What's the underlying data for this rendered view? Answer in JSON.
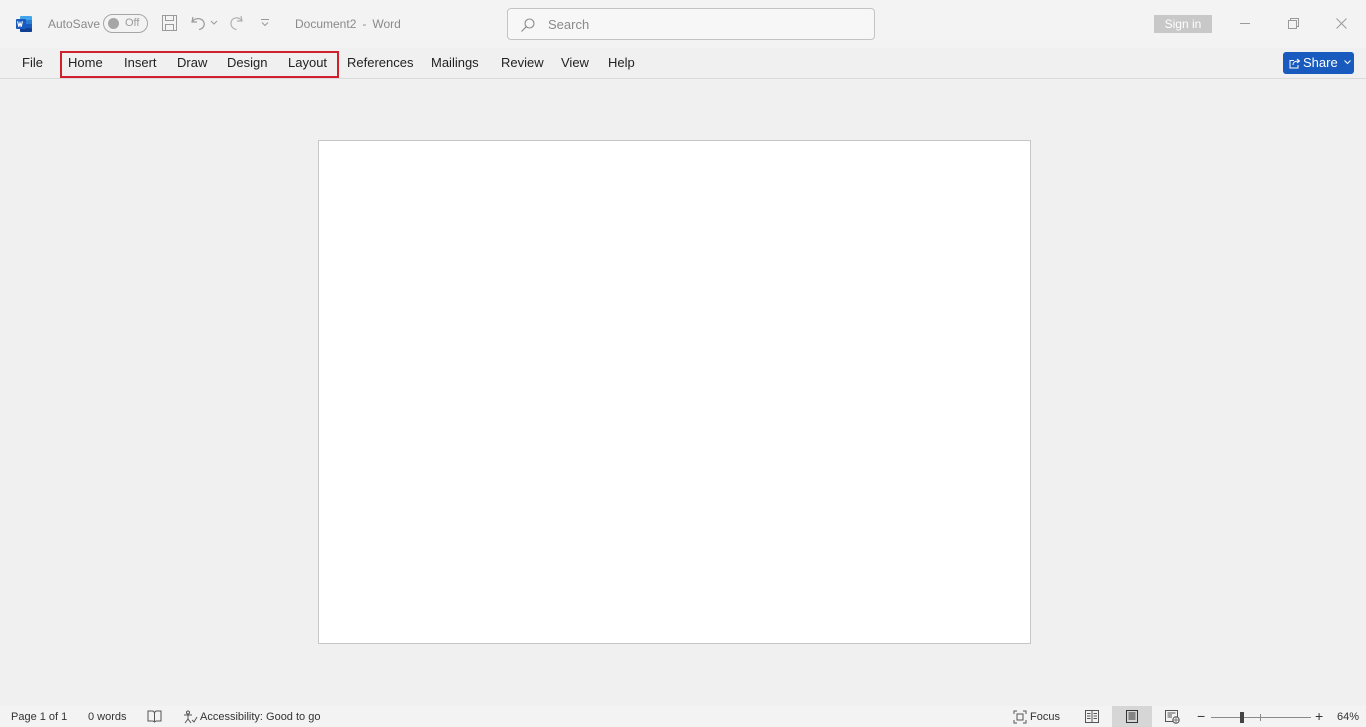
{
  "titlebar": {
    "autosave_label": "AutoSave",
    "autosave_state": "Off",
    "doc_name": "Document2",
    "separator": "-",
    "app_name": "Word",
    "search_placeholder": "Search",
    "signin_label": "Sign in"
  },
  "ribbon": {
    "tabs": [
      "File",
      "Home",
      "Insert",
      "Draw",
      "Design",
      "Layout",
      "References",
      "Mailings",
      "Review",
      "View",
      "Help"
    ],
    "share_label": "Share",
    "highlight_color": "#d0202e",
    "share_color": "#185abd"
  },
  "statusbar": {
    "page": "Page 1 of 1",
    "words": "0 words",
    "accessibility": "Accessibility: Good to go",
    "focus": "Focus",
    "zoom_percent": "64%",
    "zoom_minus": "−",
    "zoom_plus": "+"
  },
  "icons": [
    "word-logo-icon",
    "save-icon",
    "undo-icon",
    "undo-dropdown-icon",
    "redo-icon",
    "customize-qat-icon",
    "search-icon",
    "minimize-icon",
    "restore-icon",
    "close-icon",
    "share-icon",
    "chevron-down-icon",
    "proofing-icon",
    "accessibility-icon",
    "focus-icon",
    "read-mode-icon",
    "print-layout-icon",
    "web-layout-icon"
  ]
}
